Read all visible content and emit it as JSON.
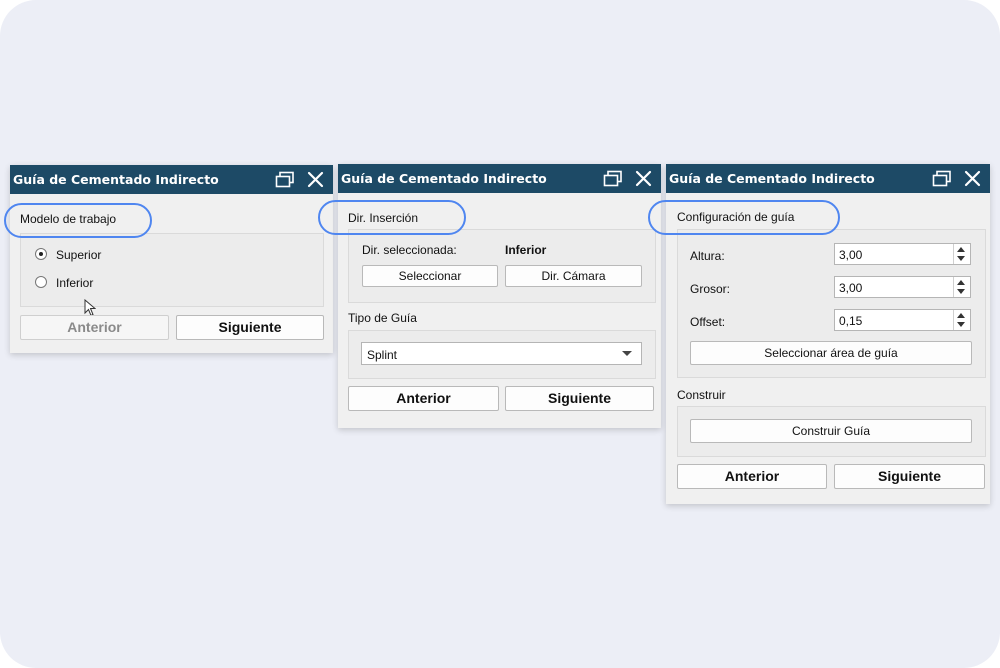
{
  "colors": {
    "titlebar": "#1d4a66",
    "highlight": "#4f86f0",
    "panel": "#f0f0f0"
  },
  "icons": {
    "restore": "restore-window-icon",
    "close": "close-icon",
    "cursor": "mouse-pointer-icon"
  },
  "panel1": {
    "title": "Guía de Cementado Indirecto",
    "section": "Modelo de trabajo",
    "options": [
      {
        "label": "Superior",
        "selected": true
      },
      {
        "label": "Inferior",
        "selected": false
      }
    ],
    "prev": "Anterior",
    "next": "Siguiente"
  },
  "panel2": {
    "title": "Guía de Cementado Indirecto",
    "section": "Dir. Inserción",
    "selected_label": "Dir. seleccionada:",
    "selected_value": "Inferior",
    "select_button": "Seleccionar",
    "camera_button": "Dir. Cámara",
    "type_label": "Tipo de Guía",
    "type_value": "Splint",
    "prev": "Anterior",
    "next": "Siguiente"
  },
  "panel3": {
    "title": "Guía de Cementado Indirecto",
    "section": "Configuración de guía",
    "height_label": "Altura:",
    "height_value": "3,00",
    "thickness_label": "Grosor:",
    "thickness_value": "3,00",
    "offset_label": "Offset:",
    "offset_value": "0,15",
    "area_button": "Seleccionar área de guía",
    "build_section": "Construir",
    "build_button": "Construir Guía",
    "prev": "Anterior",
    "next": "Siguiente"
  }
}
